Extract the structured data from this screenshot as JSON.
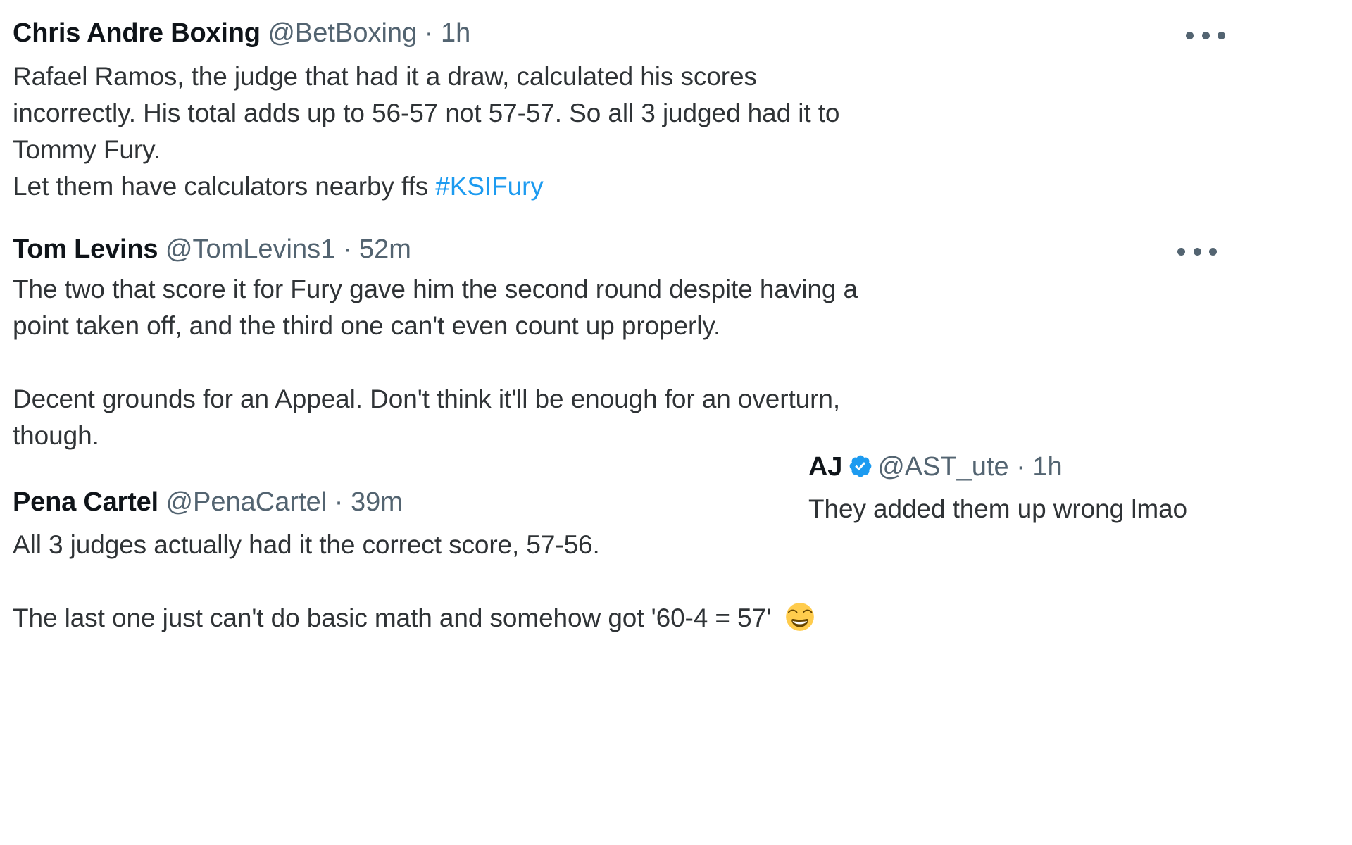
{
  "page": {
    "kind": "social-media-thread-screenshot",
    "platform_style": "twitter",
    "background_color": "#ffffff",
    "link_color": "#1d9bf0",
    "text_color": "#0f1419",
    "muted_text_color": "#536471"
  },
  "tweets": [
    {
      "id": "tweet-1",
      "display_name": "Chris Andre Boxing",
      "handle": "@BetBoxing",
      "separator": "·",
      "timestamp": "1h",
      "verified": false,
      "more_menu_label": "…",
      "paragraphs": [
        {
          "lines": [
            "Rafael Ramos, the judge that had it a draw, calculated his scores",
            "incorrectly. His total adds up to 56-57 not 57-57. So all 3 judged had it to",
            "Tommy Fury."
          ]
        },
        {
          "lines": [
            "Let them have calculators nearby ffs "
          ],
          "hashtag": "#KSIFury"
        }
      ]
    },
    {
      "id": "tweet-2",
      "display_name": "Tom Levins",
      "handle": "@TomLevins1",
      "separator": "·",
      "timestamp": "52m",
      "verified": false,
      "more_menu_label": "…",
      "paragraphs": [
        {
          "lines": [
            "The two that score it for Fury gave him the second round despite having a",
            "point taken off, and the third one can't even count up properly."
          ]
        },
        {
          "lines": [
            "Decent grounds for an Appeal. Don't think it'll be enough for an overturn,",
            "though."
          ]
        }
      ]
    },
    {
      "id": "tweet-3",
      "display_name": "AJ",
      "handle": "@AST_ute",
      "separator": "·",
      "timestamp": "1h",
      "verified": true,
      "verified_badge_color": "#1d9bf0",
      "paragraphs": [
        {
          "lines": [
            "They added them up wrong lmao"
          ]
        }
      ]
    },
    {
      "id": "tweet-4",
      "display_name": "Pena Cartel",
      "handle": "@PenaCartel",
      "separator": "·",
      "timestamp": "39m",
      "verified": false,
      "paragraphs": [
        {
          "lines": [
            "All 3 judges actually had it the correct score, 57-56."
          ]
        },
        {
          "lines": [
            "The last one just can't do basic math and somehow got '60-4 = 57' "
          ],
          "emoji": "😄",
          "emoji_name": "grinning-face-with-smiling-eyes"
        }
      ]
    }
  ]
}
